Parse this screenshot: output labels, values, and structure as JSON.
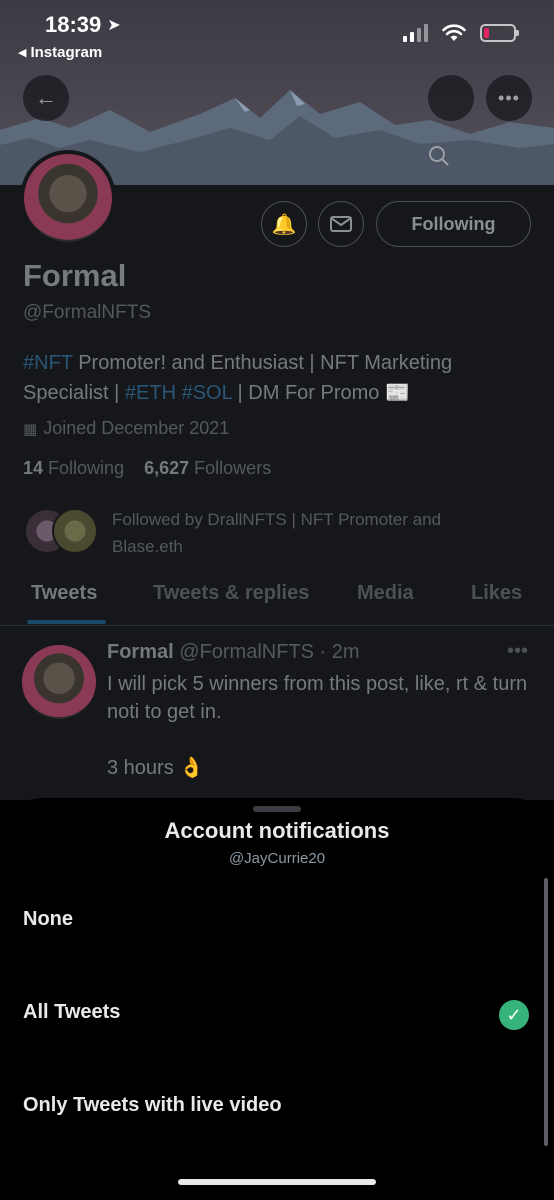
{
  "status_bar": {
    "time": "18:39",
    "back_app": "Instagram"
  },
  "profile": {
    "name": "Formal",
    "handle": "@FormalNFTS",
    "following_button": "Following",
    "bio": {
      "tag_nft": "#NFT",
      "text1": " Promoter! and Enthusiast | NFT Marketing Specialist | ",
      "tag_eth": "#ETH",
      "tag_sol": "#SOL",
      "text2": " | DM For Promo "
    },
    "joined": "Joined December 2021",
    "following_count": "14",
    "following_label": "Following",
    "followers_count": "6,627",
    "followers_label": "Followers",
    "followed_by": "Followed by DrallNFTS | NFT Promoter and Blase.eth"
  },
  "tabs": [
    "Tweets",
    "Tweets & replies",
    "Media",
    "Likes"
  ],
  "tweet": {
    "name": "Formal",
    "meta": "@FormalNFTS · 2m",
    "line1": "I will pick 5 winners from this post, like, rt & turn noti to get in.",
    "line2": "3 hours 👌"
  },
  "sheet": {
    "title": "Account notifications",
    "subtitle": "@JayCurrie20",
    "options": [
      "None",
      "All Tweets",
      "Only Tweets with live video"
    ],
    "selected": "All Tweets"
  },
  "colors": {
    "accent_blue": "#1d9bf0",
    "check_green": "#35b37a"
  }
}
